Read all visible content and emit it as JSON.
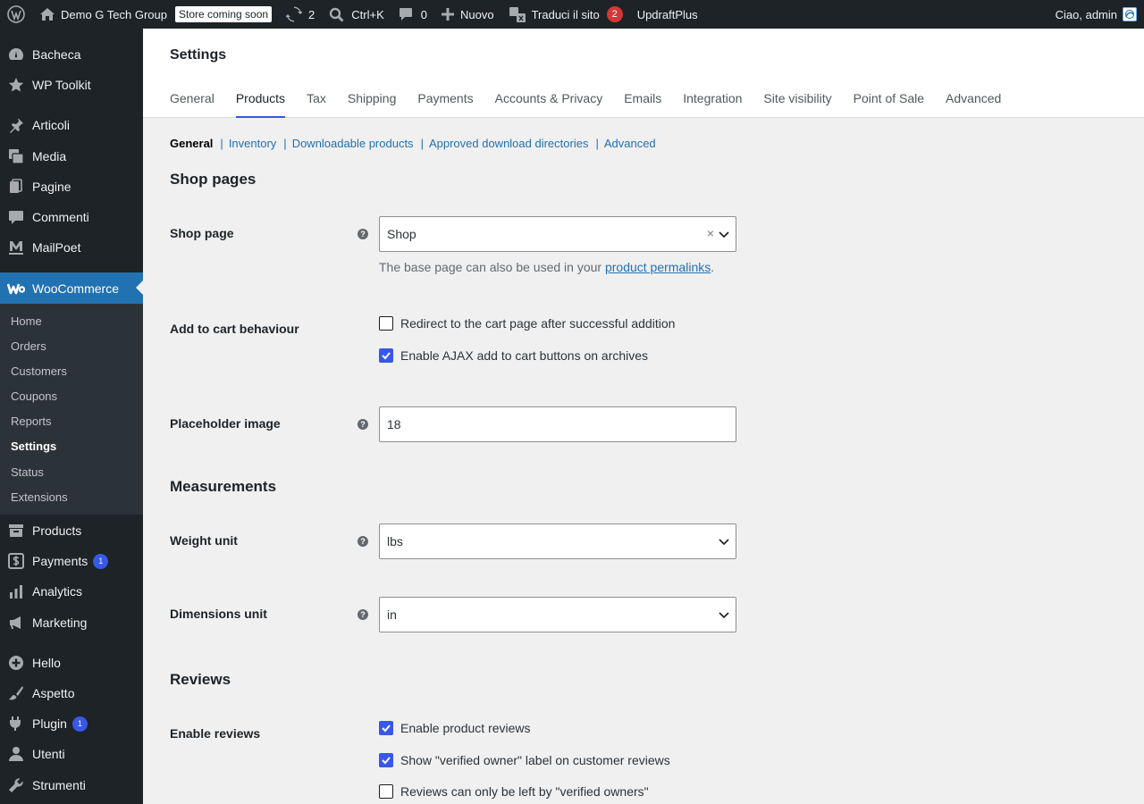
{
  "adminbar": {
    "site_name": "Demo G Tech Group",
    "store_badge": "Store coming soon",
    "updates_count": "2",
    "search_shortcut": "Ctrl+K",
    "comments_count": "0",
    "new_label": "Nuovo",
    "translate_label": "Traduci il sito",
    "translate_count": "2",
    "updraft_label": "UpdraftPlus",
    "greeting": "Ciao, admin"
  },
  "sidebar": {
    "items": [
      {
        "label": "Bacheca",
        "icon": "dashboard-icon"
      },
      {
        "label": "WP Toolkit",
        "icon": "star-icon"
      },
      {
        "label": "Articoli",
        "icon": "pin-icon"
      },
      {
        "label": "Media",
        "icon": "media-icon"
      },
      {
        "label": "Pagine",
        "icon": "pages-icon"
      },
      {
        "label": "Commenti",
        "icon": "comment-icon"
      },
      {
        "label": "MailPoet",
        "icon": "mailpoet-icon"
      },
      {
        "label": "WooCommerce",
        "icon": "woo-icon"
      },
      {
        "label": "Products",
        "icon": "archive-icon"
      },
      {
        "label": "Payments",
        "icon": "dollar-icon",
        "badge": "1"
      },
      {
        "label": "Analytics",
        "icon": "chart-bar-icon"
      },
      {
        "label": "Marketing",
        "icon": "megaphone-icon"
      },
      {
        "label": "Hello",
        "icon": "plus-circle-icon"
      },
      {
        "label": "Aspetto",
        "icon": "brush-icon"
      },
      {
        "label": "Plugin",
        "icon": "plug-icon",
        "badge": "1"
      },
      {
        "label": "Utenti",
        "icon": "user-icon"
      },
      {
        "label": "Strumenti",
        "icon": "wrench-icon"
      }
    ],
    "submenu": [
      "Home",
      "Orders",
      "Customers",
      "Coupons",
      "Reports",
      "Settings",
      "Status",
      "Extensions"
    ]
  },
  "header": {
    "title": "Settings",
    "tabs": [
      "General",
      "Products",
      "Tax",
      "Shipping",
      "Payments",
      "Accounts & Privacy",
      "Emails",
      "Integration",
      "Site visibility",
      "Point of Sale",
      "Advanced"
    ]
  },
  "subnav": {
    "current": "General",
    "links": [
      "Inventory",
      "Downloadable products",
      "Approved download directories",
      "Advanced"
    ]
  },
  "shop_pages": {
    "title": "Shop pages",
    "shop_page_label": "Shop page",
    "shop_page_value": "Shop",
    "shop_page_desc_prefix": "The base page can also be used in your ",
    "shop_page_desc_link": "product permalinks",
    "shop_page_desc_suffix": ".",
    "add_to_cart_label": "Add to cart behaviour",
    "redirect_label": "Redirect to the cart page after successful addition",
    "ajax_label": "Enable AJAX add to cart buttons on archives",
    "placeholder_label": "Placeholder image",
    "placeholder_value": "18"
  },
  "measurements": {
    "title": "Measurements",
    "weight_label": "Weight unit",
    "weight_value": "lbs",
    "dimensions_label": "Dimensions unit",
    "dimensions_value": "in"
  },
  "reviews": {
    "title": "Reviews",
    "enable_label": "Enable reviews",
    "product_reviews_label": "Enable product reviews",
    "verified_label": "Show \"verified owner\" label on customer reviews",
    "only_verified_label": "Reviews can only be left by \"verified owners\""
  },
  "help_glyph": "?",
  "clear_glyph": "×",
  "colors": {
    "accent": "#3858e9",
    "sidebar_bg": "#1d2327",
    "active_menu": "#2271b1"
  }
}
